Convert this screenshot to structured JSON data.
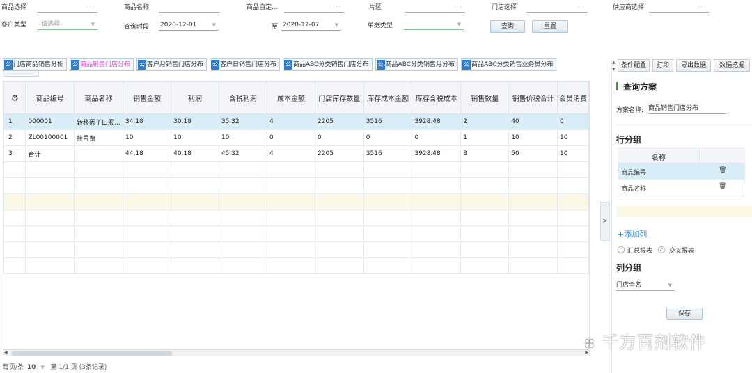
{
  "filters": {
    "row1": [
      {
        "label": "商品选择",
        "value": "",
        "trail": "···"
      },
      {
        "label": "商品名称",
        "value": "",
        "trail": ""
      },
      {
        "label": "商品自定...",
        "value": "",
        "trail": "···"
      },
      {
        "label": "片区",
        "value": "",
        "trail": "···"
      },
      {
        "label": "门店选择",
        "value": "",
        "trail": "···"
      },
      {
        "label": "供应商选择",
        "value": "",
        "trail": "···"
      }
    ],
    "customer_type_label": "客户类型",
    "customer_type_value": "-请选择-",
    "query_period_label": "查询时段",
    "date_from": "2020-12-01",
    "to_label": "至",
    "date_to": "2020-12-07",
    "doc_type_label": "单据类型",
    "doc_type_value": "",
    "query_button": "查询",
    "reset_button": "重置"
  },
  "tabs": [
    {
      "icon": "公",
      "label": "门店商品销售分析",
      "active": false
    },
    {
      "icon": "公",
      "label": "商品销售门店分布",
      "active": true
    },
    {
      "icon": "公",
      "label": "客户月销售门店分布",
      "active": false
    },
    {
      "icon": "公",
      "label": "客户日销售门店分布",
      "active": false
    },
    {
      "icon": "公",
      "label": "商品ABC分类销售门店分布",
      "active": false
    },
    {
      "icon": "公",
      "label": "商品ABC分类销售月分布",
      "active": false
    },
    {
      "icon": "公",
      "label": "商品ABC分类销售业务员分布",
      "active": false
    }
  ],
  "table": {
    "settings_icon": "⚙",
    "columns": [
      "商品编号",
      "商品名称",
      "销售金额",
      "利润",
      "含税利润",
      "成本金额",
      "门店库存数量",
      "库存成本金额",
      "库存含税成本",
      "销售数量",
      "销售价税合计",
      "会员消费"
    ],
    "rows": [
      [
        "1",
        "000001",
        "转移因子口服...",
        "34.18",
        "30.18",
        "35.32",
        "4",
        "2205",
        "3516",
        "3928.48",
        "2",
        "40",
        "0"
      ],
      [
        "2",
        "ZL00100001",
        "挂号费",
        "10",
        "10",
        "10",
        "0",
        "0",
        "0",
        "0",
        "1",
        "10",
        "10"
      ],
      [
        "3",
        "合计",
        "",
        "44.18",
        "40.18",
        "45.32",
        "4",
        "2205",
        "3516",
        "3928.48",
        "3",
        "50",
        "10"
      ]
    ],
    "empty_rows": 7
  },
  "pager": {
    "page_size_label": "每页/条",
    "page_size": "10",
    "page_info": "第 1/1 页 (3条记录)"
  },
  "panel": {
    "toolbar": [
      "条件配置",
      "打印",
      "导出数据",
      "数据挖掘"
    ],
    "query_scheme_title": "查询方案",
    "scheme_name_label": "方案名称:",
    "scheme_name_value": "商品销售门店分布",
    "row_group_title": "行分组",
    "row_group_header": "名称",
    "row_groups": [
      "商品编号",
      "商品名称"
    ],
    "add_column": "+添加列",
    "summary_report": "汇总报表",
    "cross_report": "交叉报表",
    "col_group_title": "列分组",
    "col_group_value": "门店全名",
    "save_button": "保存"
  },
  "collapse_arrow": ">",
  "watermark": "千方百剂软件"
}
